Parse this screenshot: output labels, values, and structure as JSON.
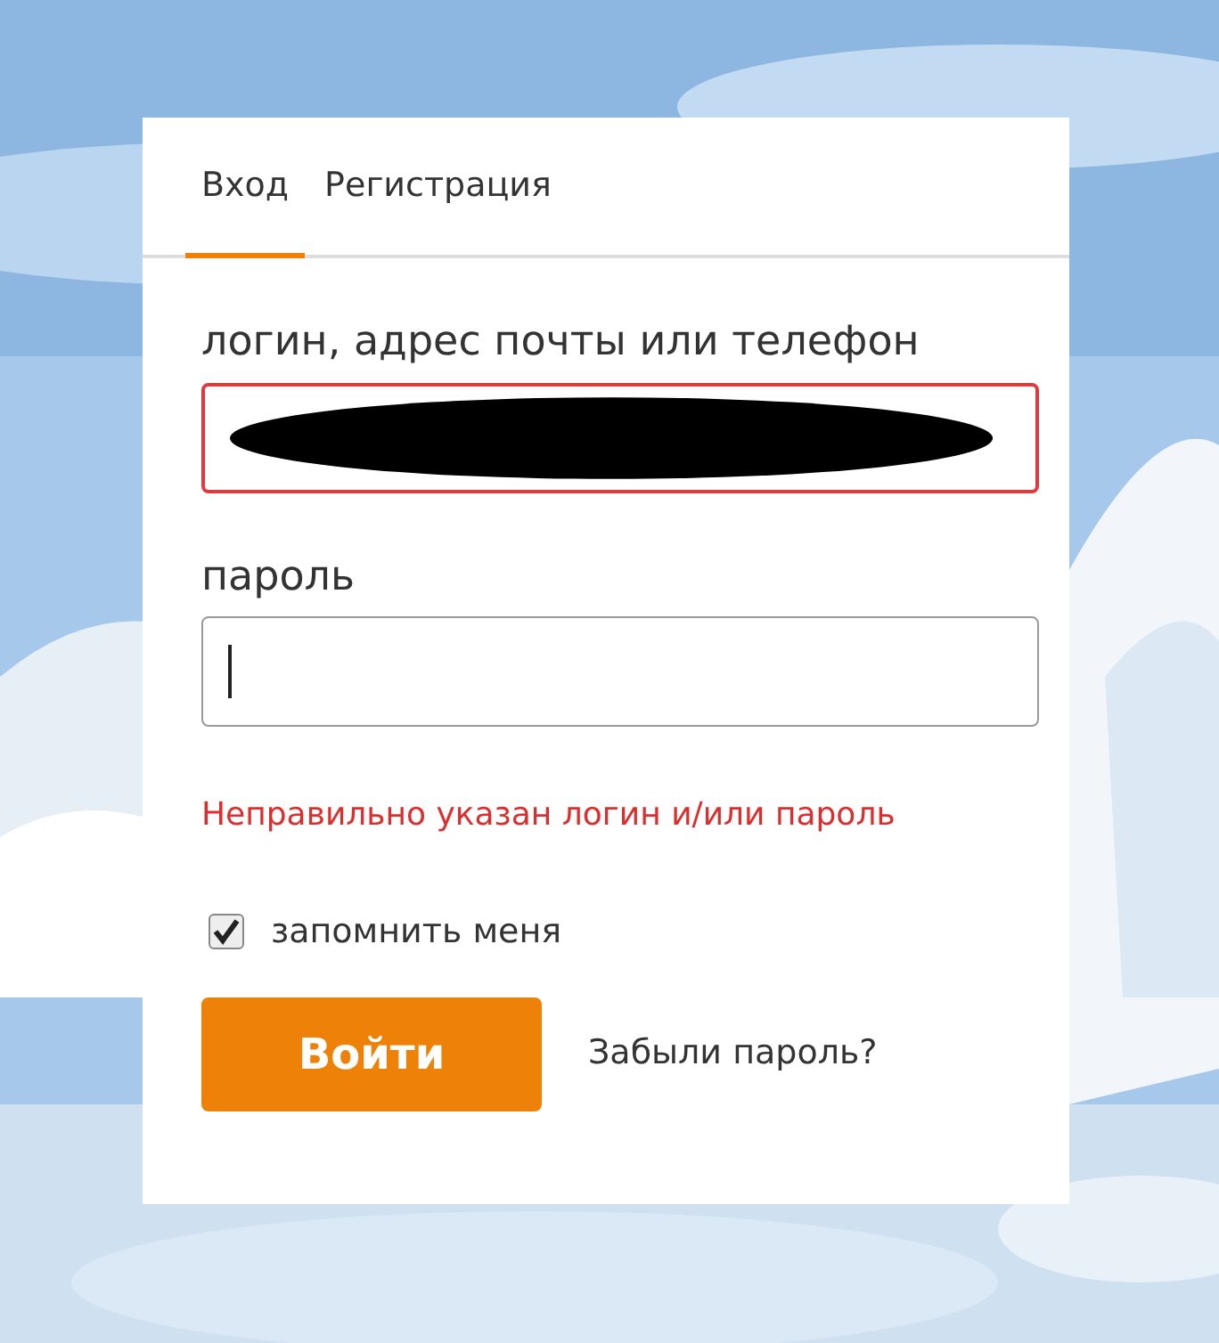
{
  "tabs": [
    {
      "label": "Вход",
      "selected": true
    },
    {
      "label": "Регистрация",
      "selected": false
    }
  ],
  "login_field": {
    "label": "логин, адрес почты или телефон",
    "invalid": true,
    "redacted": true
  },
  "password_field": {
    "label": "пароль",
    "focused": true
  },
  "error_message": "Неправильно указан логин и/или пароль",
  "remember_me": {
    "label": "запомнить меня",
    "checked": true
  },
  "submit_button": "Войти",
  "forgot_link": "Забыли пароль?"
}
